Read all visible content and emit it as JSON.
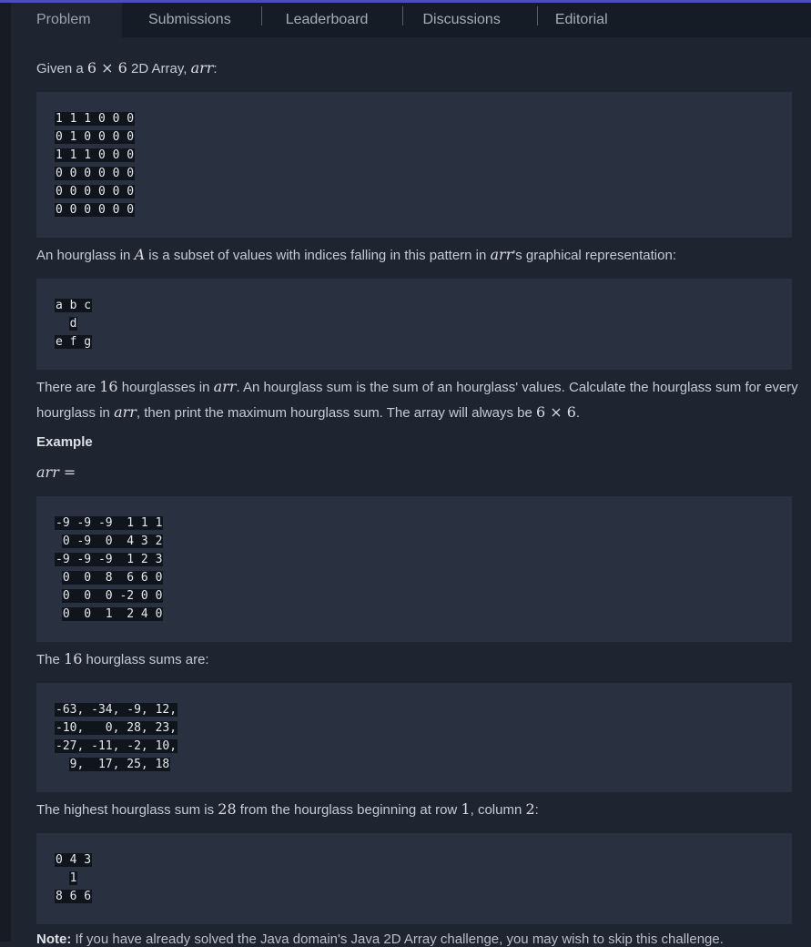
{
  "tabs": [
    {
      "label": "Problem",
      "active": true
    },
    {
      "label": "Submissions",
      "active": false
    },
    {
      "label": "Leaderboard",
      "active": false
    },
    {
      "label": "Discussions",
      "active": false
    },
    {
      "label": "Editorial",
      "active": false
    }
  ],
  "intro": {
    "pre": "Given a ",
    "size": "6 × 6",
    "mid": " 2D Array, ",
    "var": "arr",
    "post": ":"
  },
  "grid1": [
    "1 1 1 0 0 0",
    "0 1 0 0 0 0",
    "1 1 1 0 0 0",
    "0 0 0 0 0 0",
    "0 0 0 0 0 0",
    "0 0 0 0 0 0"
  ],
  "hourglass_def": {
    "pre": "An hourglass in ",
    "var_a": "A",
    "mid": " is a subset of values with indices falling in this pattern in ",
    "var_arr": "arr",
    "post": "'s graphical representation:"
  },
  "pattern": [
    "a b c",
    "  d",
    "e f g"
  ],
  "count_para": {
    "line1_pre": "There are ",
    "count": "16",
    "line1_mid": " hourglasses in ",
    "var_arr": "arr",
    "line1_post": ". An hourglass sum is the sum of an hourglass' values. Calculate the hourglass sum for every",
    "line2_pre": "hourglass in ",
    "line2_var": "arr",
    "line2_mid": ", then print the maximum hourglass sum. The array will always be ",
    "line2_size": "6 × 6",
    "line2_post": "."
  },
  "example_heading": "Example",
  "example_var": "arr =",
  "grid2": [
    "-9 -9 -9  1 1 1",
    " 0 -9  0  4 3 2",
    "-9 -9 -9  1 2 3",
    " 0  0  8  6 6 0",
    " 0  0  0 -2 0 0",
    " 0  0  1  2 4 0"
  ],
  "sums_intro": {
    "pre": "The ",
    "count": "16",
    "post": " hourglass sums are:"
  },
  "sums": [
    "-63, -34, -9, 12,",
    "-10,   0, 28, 23,",
    "-27, -11, -2, 10,",
    "  9,  17, 25, 18"
  ],
  "highest": {
    "pre": "The highest hourglass sum is ",
    "value": "28",
    "mid": " from the hourglass beginning at row ",
    "row": "1",
    "mid2": ", column ",
    "col": "2",
    "post": ":"
  },
  "best": [
    "0 4 3",
    "  1",
    "8 6 6"
  ],
  "note": {
    "label": "Note:",
    "text": " If you have already solved the Java domain's Java 2D Array challenge, you may wish to skip this challenge."
  }
}
